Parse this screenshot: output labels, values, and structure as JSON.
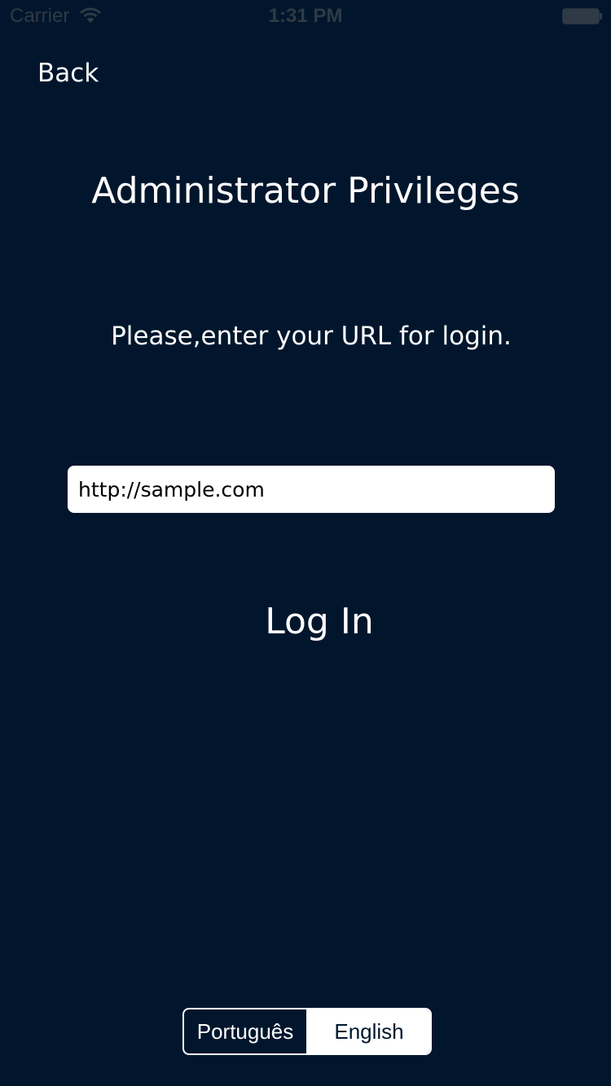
{
  "status_bar": {
    "carrier": "Carrier",
    "time": "1:31 PM",
    "wifi_icon": "wifi-icon",
    "battery_icon": "battery-icon"
  },
  "nav": {
    "back_label": "Back"
  },
  "main": {
    "title": "Administrator Privileges",
    "instruction": "Please,enter your URL for login.",
    "url_value": "http://sample.com",
    "login_label": "Log In"
  },
  "language": {
    "options": [
      "Português",
      "English"
    ],
    "selected": "English"
  },
  "colors": {
    "background": "#01162c",
    "text": "#ffffff",
    "status_text": "#2f3a46"
  }
}
